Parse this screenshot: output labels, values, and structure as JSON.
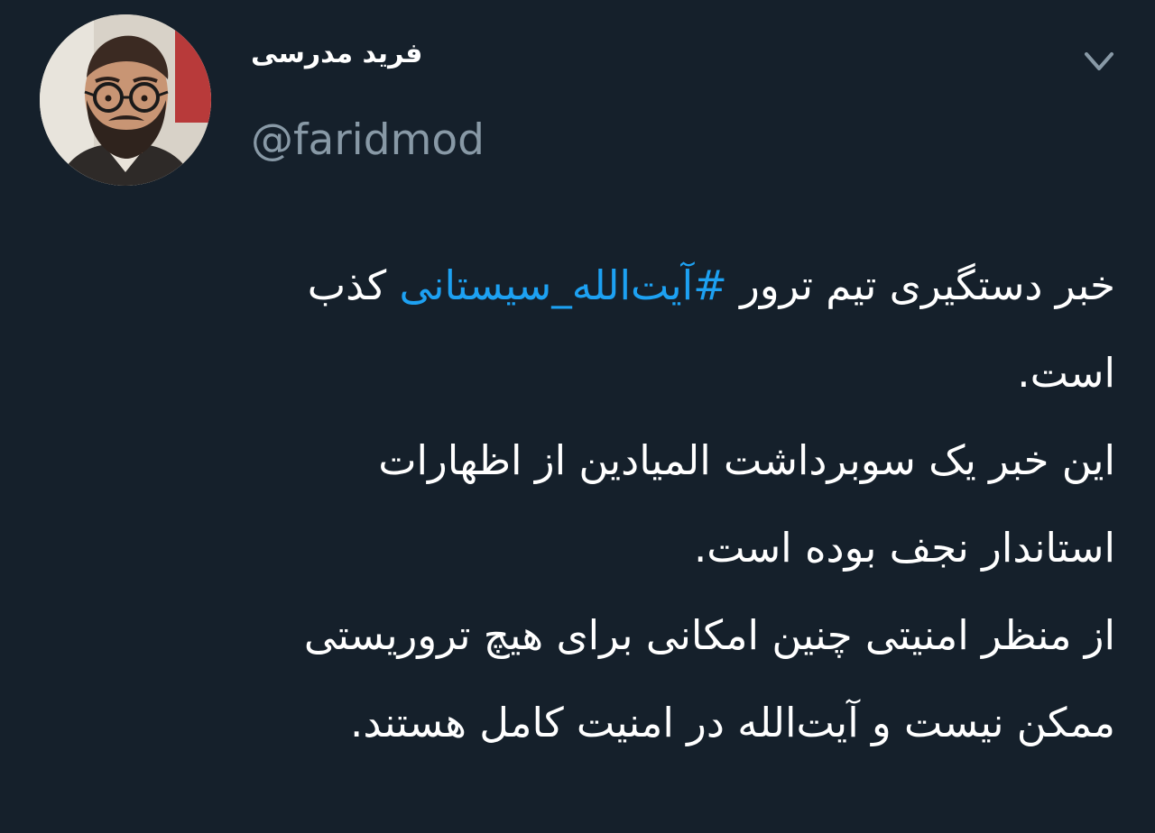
{
  "author": {
    "display_name": "فرید مدرسی",
    "handle": "@faridmod",
    "avatar_icon": "user-avatar-photo"
  },
  "menu": {
    "icon": "chevron-down-icon"
  },
  "tweet": {
    "line1_before": "خبر دستگیری تیم ترور ",
    "hashtag": "#آیت‌الله_سیستانی",
    "line1_after": " کذب",
    "line2": "است.",
    "line3": "این خبر یک سوبرداشت المیادین از اظهارات",
    "line4": "استاندار نجف بوده است.",
    "line5": "از منظر امنیتی چنین امکانی برای هیچ تروریستی",
    "line6": "ممکن نیست و آیت‌الله در امنیت کامل هستند."
  },
  "colors": {
    "background": "#15202b",
    "text": "#ffffff",
    "secondary": "#8899a6",
    "link": "#1da1f2"
  }
}
